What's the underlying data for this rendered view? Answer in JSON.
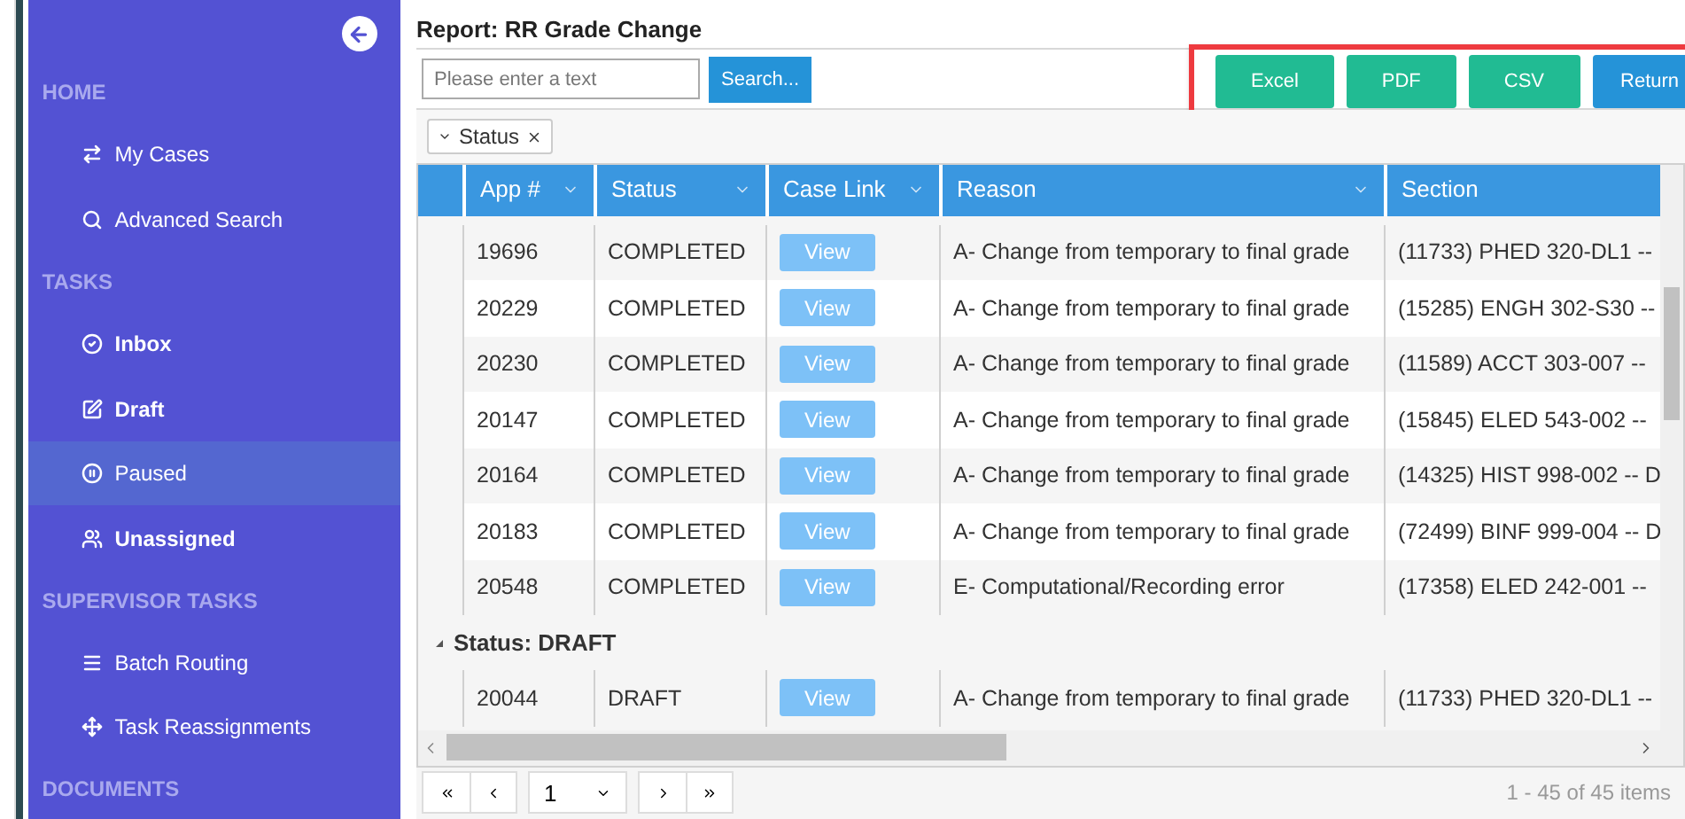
{
  "sidebar": {
    "items": [
      {
        "kind": "section",
        "label": "HOME"
      },
      {
        "kind": "item",
        "label": "My Cases",
        "bold": false,
        "selected": false
      },
      {
        "kind": "item",
        "label": "Advanced Search",
        "bold": false,
        "selected": false
      },
      {
        "kind": "section",
        "label": "TASKS"
      },
      {
        "kind": "item",
        "label": "Inbox",
        "bold": true,
        "selected": false
      },
      {
        "kind": "item",
        "label": "Draft",
        "bold": true,
        "selected": false
      },
      {
        "kind": "item",
        "label": "Paused",
        "bold": false,
        "selected": true
      },
      {
        "kind": "item",
        "label": "Unassigned",
        "bold": true,
        "selected": false
      },
      {
        "kind": "section",
        "label": "SUPERVISOR TASKS"
      },
      {
        "kind": "item",
        "label": "Batch Routing",
        "bold": false,
        "selected": false
      },
      {
        "kind": "item",
        "label": "Task Reassignments",
        "bold": false,
        "selected": false
      },
      {
        "kind": "section",
        "label": "DOCUMENTS"
      }
    ]
  },
  "report": {
    "title": "Report: RR Grade Change",
    "search": {
      "placeholder": "Please enter a text",
      "button": "Search..."
    },
    "actions": [
      {
        "kind": "export",
        "label": "Excel"
      },
      {
        "kind": "export",
        "label": "PDF"
      },
      {
        "kind": "export",
        "label": "CSV"
      },
      {
        "kind": "primary",
        "label": "Return"
      }
    ],
    "group_chip": "Status",
    "table": {
      "columns": [
        "App #",
        "Status",
        "Case Link",
        "Reason",
        "Section"
      ],
      "rows": [
        {
          "kind": "row",
          "cells": [
            "19696",
            "COMPLETED",
            "View",
            "A- Change from temporary to final grade",
            "(11733) PHED 320-DL1 --"
          ]
        },
        {
          "kind": "row",
          "cells": [
            "20229",
            "COMPLETED",
            "View",
            "A- Change from temporary to final grade",
            "(15285) ENGH 302-S30 --"
          ]
        },
        {
          "kind": "row",
          "cells": [
            "20230",
            "COMPLETED",
            "View",
            "A- Change from temporary to final grade",
            "(11589) ACCT 303-007 --"
          ]
        },
        {
          "kind": "row",
          "cells": [
            "20147",
            "COMPLETED",
            "View",
            "A- Change from temporary to final grade",
            "(15845) ELED 543-002 --"
          ]
        },
        {
          "kind": "row",
          "cells": [
            "20164",
            "COMPLETED",
            "View",
            "A- Change from temporary to final grade",
            "(14325) HIST 998-002 -- D"
          ]
        },
        {
          "kind": "row",
          "cells": [
            "20183",
            "COMPLETED",
            "View",
            "A- Change from temporary to final grade",
            "(72499) BINF 999-004 -- D"
          ]
        },
        {
          "kind": "row",
          "cells": [
            "20548",
            "COMPLETED",
            "View",
            "E- Computational/Recording error",
            "(17358) ELED 242-001 --"
          ]
        },
        {
          "kind": "group",
          "label": "Status: DRAFT",
          "expanded": true
        },
        {
          "kind": "row",
          "cells": [
            "20044",
            "DRAFT",
            "View",
            "A- Change from temporary to final grade",
            "(11733) PHED 320-DL1 --"
          ]
        }
      ]
    },
    "pager": {
      "page": "1",
      "summary": "1 - 45 of 45 items"
    }
  }
}
